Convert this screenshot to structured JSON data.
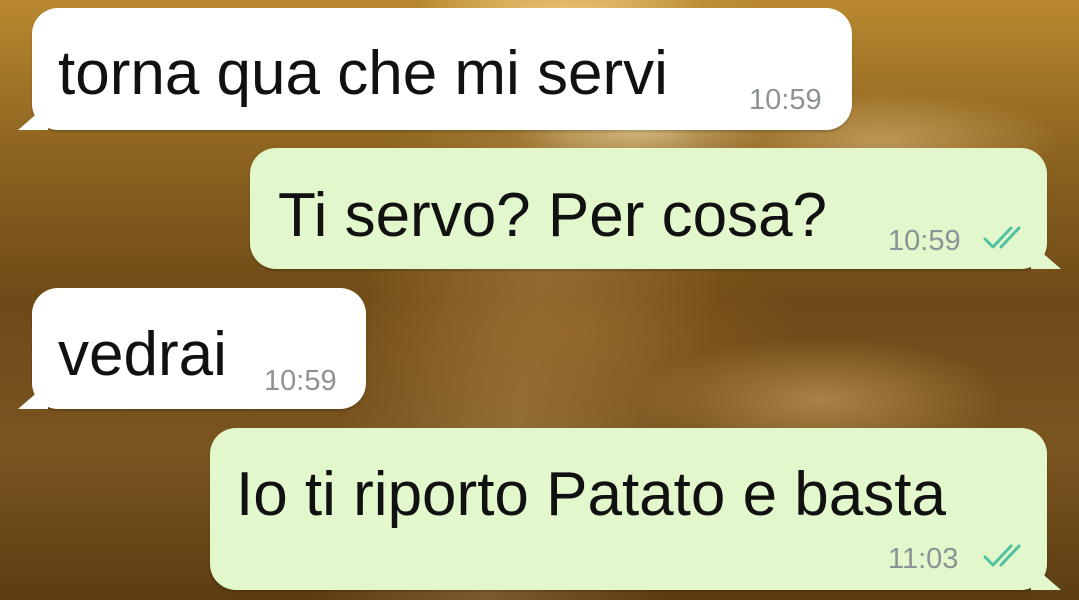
{
  "messages": [
    {
      "direction": "incoming",
      "text": "torna qua che mi servi",
      "time": "10:59"
    },
    {
      "direction": "outgoing",
      "text": "Ti servo? Per cosa?",
      "time": "10:59",
      "status_icon": "double-check-icon",
      "status_color": "#4fc3a1"
    },
    {
      "direction": "incoming",
      "text": "vedrai",
      "time": "10:59"
    },
    {
      "direction": "outgoing",
      "text": "Io ti riporto Patato e basta",
      "time": "11:03",
      "status_icon": "double-check-icon",
      "status_color": "#4fc3a1"
    }
  ],
  "colors": {
    "incoming_bubble": "#ffffff",
    "outgoing_bubble": "#e2f7cb",
    "timestamp": "#8c9396"
  }
}
